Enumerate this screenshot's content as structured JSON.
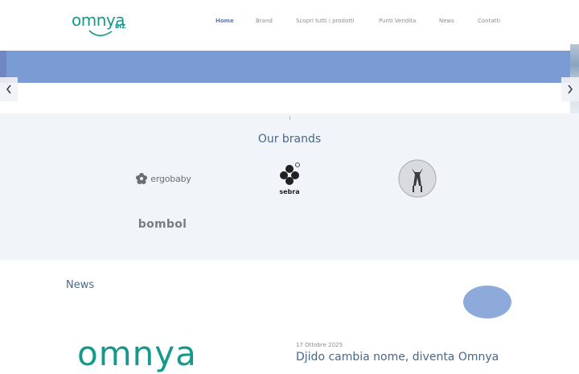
{
  "header": {
    "logo": {
      "word": "omnya",
      "sub": "BIZ"
    },
    "nav": [
      {
        "label": "Home",
        "active": true
      },
      {
        "label": "Brand",
        "active": false
      },
      {
        "label": "Scopri tutti i prodotti",
        "active": false
      },
      {
        "label": "Punti Vendita",
        "active": false
      },
      {
        "label": "News",
        "active": false
      },
      {
        "label": "Contatti",
        "active": false
      }
    ]
  },
  "hero": {
    "prev_icon": "chevron-left-icon",
    "next_icon": "chevron-right-icon",
    "accent_color": "#7a9bd3"
  },
  "brands": {
    "title": "Our brands",
    "items": [
      {
        "name": "ergobaby"
      },
      {
        "name": "sebra"
      },
      {
        "name": "deer-logo"
      },
      {
        "name": "bombol"
      }
    ],
    "ergobaby_label": "ergobaby",
    "bombol_label": "bombol",
    "sebra_label": "sebra"
  },
  "news": {
    "title": "News",
    "post": {
      "image_text": "omnya",
      "date": "17 Ottobre 2025",
      "title": "Djido cambia nome, diventa Omnya"
    }
  },
  "colors": {
    "brand_green": "#139a8c",
    "link_blue": "#5b78c2",
    "heading_blue": "#4a6789"
  }
}
